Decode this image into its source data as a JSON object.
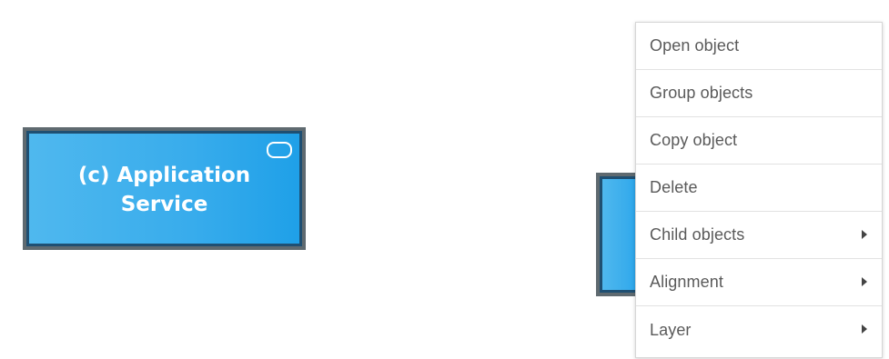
{
  "canvas": {
    "nodes": [
      {
        "label": "(c) Application Service",
        "icon": "application-service-icon",
        "fill_color": "#38acec",
        "border_color": "#5f6a70"
      }
    ]
  },
  "context_menu": {
    "items": [
      {
        "label": "Open object",
        "has_submenu": false
      },
      {
        "label": "Group objects",
        "has_submenu": false
      },
      {
        "label": "Copy object",
        "has_submenu": false
      },
      {
        "label": "Delete",
        "has_submenu": false
      },
      {
        "label": "Child objects",
        "has_submenu": true,
        "icon": "chevron-right-icon"
      },
      {
        "label": "Alignment",
        "has_submenu": true,
        "icon": "chevron-right-icon"
      },
      {
        "label": "Layer",
        "has_submenu": true,
        "icon": "chevron-right-icon"
      }
    ]
  }
}
